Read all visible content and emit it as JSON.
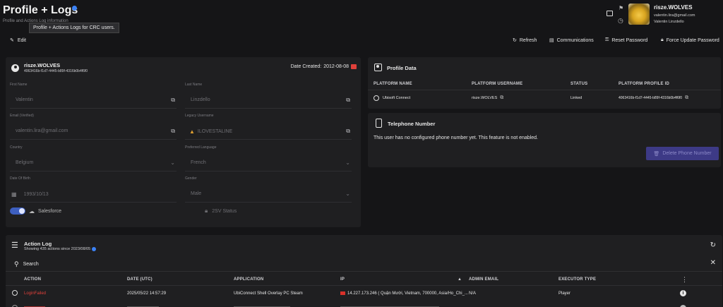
{
  "header": {
    "title": "Profile + Logs",
    "subtitle": "Profile and Actions Log information",
    "tooltip": "Profile + Actions Logs for CRC users.",
    "edit_label": "Edit"
  },
  "account": {
    "username": "risze.WOLVES",
    "email": "valentin.lira@gmail.com",
    "real_name": "Valentin Linzdello"
  },
  "toolbar": {
    "refresh": "Refresh",
    "communications": "Communications",
    "reset_password": "Reset Password",
    "force_update_password": "Force Update Password"
  },
  "profile": {
    "username": "risze.WOLVES",
    "user_id": "4063416b-f1d7-4445-b89f-4316b0b4f6f0",
    "date_created_label": "Date Created:",
    "date_created": "2012-08-08",
    "first_name_label": "First Name",
    "first_name": "Valentin",
    "last_name_label": "Last Name",
    "last_name": "Linzdello",
    "email_label": "Email (Verified)",
    "email": "valentin.lira@gmail.com",
    "legacy_label": "Legacy Username",
    "legacy": "ILOVESTALINE",
    "country_label": "Country",
    "country": "Belgium",
    "language_label": "Preferred Language",
    "language": "French",
    "dob_label": "Date Of Birth",
    "dob": "1993/10/13",
    "gender_label": "Gender",
    "gender": "Male",
    "salesforce": "Salesforce",
    "two_sv": "2SV Status"
  },
  "profile_data": {
    "title": "Profile Data",
    "columns": [
      "PLATFORM NAME",
      "PLATFORM USERNAME",
      "STATUS",
      "PLATFORM PROFILE ID"
    ],
    "row": {
      "platform": "Ubisoft Connect",
      "username": "risze.WOLVES",
      "status": "Linked",
      "profile_id": "4063416b-f1d7-4445-b89f-4316b0b4f6f0"
    }
  },
  "telephone": {
    "title": "Telephone Number",
    "message": "This user has no configured phone number yet. This feature is not enabled.",
    "delete_button": "Delete Phone Number"
  },
  "action_log": {
    "title": "Action Log",
    "subtitle": "Showing 435 actions since 2023/08/05",
    "search_placeholder": "Search",
    "columns": [
      "ACTION",
      "DATE (UTC)",
      "APPLICATION",
      "IP",
      "ADMIN EMAIL",
      "EXECUTOR TYPE"
    ],
    "rows": [
      {
        "action": "LoginFailed",
        "date": "2025/05/22 14:57:29",
        "application": "UbiConnect Shell Overlay PC Steam",
        "ip": "14.227.173.246 ( Quận Mười, Vietnam, 700000, Asia/Ho_Chi_...",
        "admin_email": "N/A",
        "executor": "Player"
      }
    ]
  },
  "colors": {
    "accent": "#3b82f6",
    "danger": "#e0403a",
    "warning": "#e0a030",
    "button_disabled": "#3d3a86"
  }
}
